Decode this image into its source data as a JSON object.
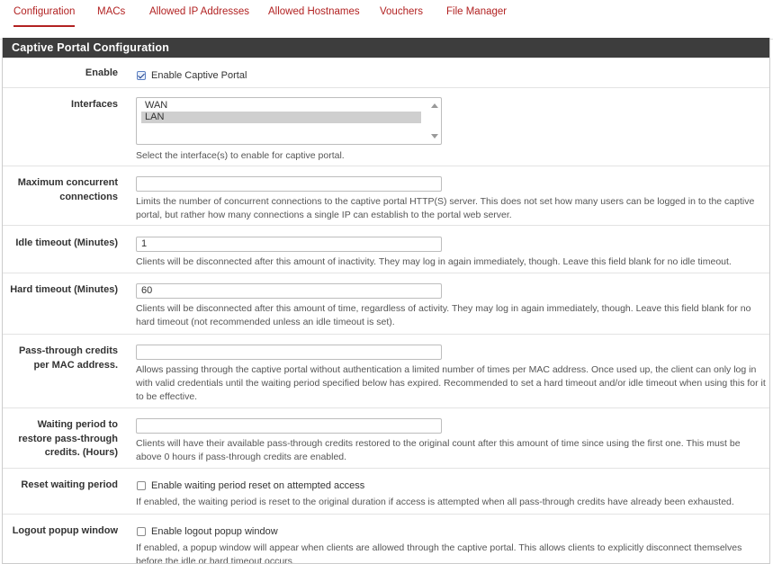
{
  "tabs": [
    {
      "label": "Configuration",
      "active": true
    },
    {
      "label": "MACs"
    },
    {
      "label": "Allowed IP Addresses"
    },
    {
      "label": "Allowed Hostnames"
    },
    {
      "label": "Vouchers"
    },
    {
      "label": "File Manager"
    }
  ],
  "panel": {
    "title": "Captive Portal Configuration"
  },
  "enable": {
    "label": "Enable",
    "checkbox_label": "Enable Captive Portal",
    "checked": true
  },
  "interfaces": {
    "label": "Interfaces",
    "options": [
      {
        "label": "WAN",
        "selected": false
      },
      {
        "label": "LAN",
        "selected": true
      }
    ],
    "help": "Select the interface(s) to enable for captive portal."
  },
  "max_connections": {
    "label": "Maximum concurrent connections",
    "value": "",
    "help": "Limits the number of concurrent connections to the captive portal HTTP(S) server. This does not set how many users can be logged in to the captive portal, but rather how many connections a single IP can establish to the portal web server."
  },
  "idle_timeout": {
    "label": "Idle timeout (Minutes)",
    "value": "1",
    "help": "Clients will be disconnected after this amount of inactivity. They may log in again immediately, though. Leave this field blank for no idle timeout."
  },
  "hard_timeout": {
    "label": "Hard timeout (Minutes)",
    "value": "60",
    "help": "Clients will be disconnected after this amount of time, regardless of activity. They may log in again immediately, though. Leave this field blank for no hard timeout (not recommended unless an idle timeout is set)."
  },
  "passthrough_credits": {
    "label": "Pass-through credits per MAC address.",
    "value": "",
    "help": "Allows passing through the captive portal without authentication a limited number of times per MAC address. Once used up, the client can only log in with valid credentials until the waiting period specified below has expired. Recommended to set a hard timeout and/or idle timeout when using this for it to be effective."
  },
  "waiting_period": {
    "label": "Waiting period to restore pass-through credits. (Hours)",
    "value": "",
    "help": "Clients will have their available pass-through credits restored to the original count after this amount of time since using the first one. This must be above 0 hours if pass-through credits are enabled."
  },
  "reset_waiting": {
    "label": "Reset waiting period",
    "checkbox_label": "Enable waiting period reset on attempted access",
    "checked": false,
    "help": "If enabled, the waiting period is reset to the original duration if access is attempted when all pass-through credits have already been exhausted."
  },
  "logout_popup": {
    "label": "Logout popup window",
    "checkbox_label": "Enable logout popup window",
    "checked": false,
    "help": "If enabled, a popup window will appear when clients are allowed through the captive portal. This allows clients to explicitly disconnect themselves before the idle or hard timeout occurs."
  }
}
